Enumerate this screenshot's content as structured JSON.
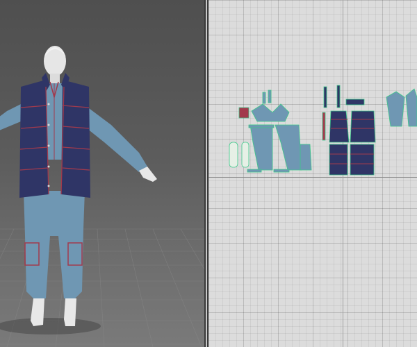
{
  "app": {
    "panels": [
      {
        "id": "3d",
        "label": ""
      },
      {
        "id": "2d",
        "label": ""
      }
    ]
  },
  "colors": {
    "vest": "#2f3566",
    "vest_seams": "#a23a4c",
    "suit": "#6f97b3",
    "skin": "#e8e8e8",
    "pattern_fill_blue": "#6f97b3",
    "pattern_fill_navy": "#2f3566",
    "pattern_outline": "#3ec98a",
    "grid_bg": "#dcdcdc",
    "viewport_bg": "#5c5c5c"
  },
  "icons": [
    "avatar-figure",
    "pattern-piece"
  ]
}
